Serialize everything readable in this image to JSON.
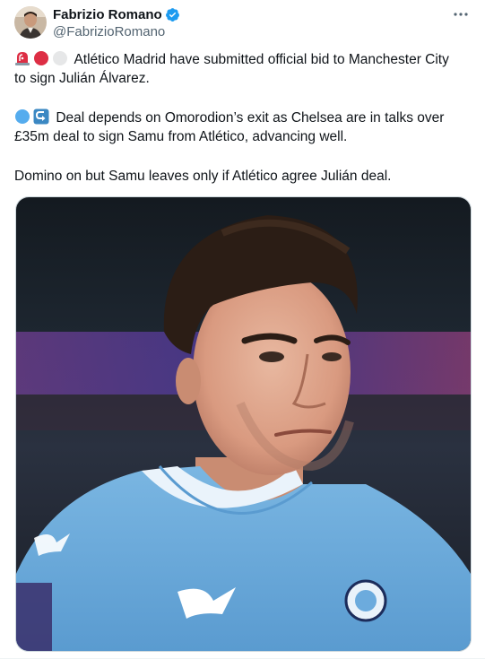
{
  "author": {
    "name": "Fabrizio Romano",
    "handle": "@FabrizioRomano",
    "verified": true,
    "verified_color": "#1d9bf0"
  },
  "menu_icon": "more-horizontal-icon",
  "tweet": {
    "paragraph1": {
      "emojis": [
        "rotating-light-emoji",
        "red-circle-emoji",
        "white-circle-emoji"
      ],
      "line1": "Atlético Madrid have submitted official bid to Manchester City",
      "line2": "to sign Julián Álvarez."
    },
    "paragraph2": {
      "emojis": [
        "blue-circle-emoji",
        "leftwards-hook-arrow-emoji"
      ],
      "line1": "Deal depends on Omorodion’s exit as Chelsea are in talks over",
      "line2": "£35m deal to sign Samu from Atlético, advancing well."
    },
    "paragraph3": {
      "line1": "Domino on but Samu leaves only if Atlético agree Julián deal."
    }
  },
  "media": {
    "description": "photo",
    "kit_color": "#6cabdd"
  }
}
